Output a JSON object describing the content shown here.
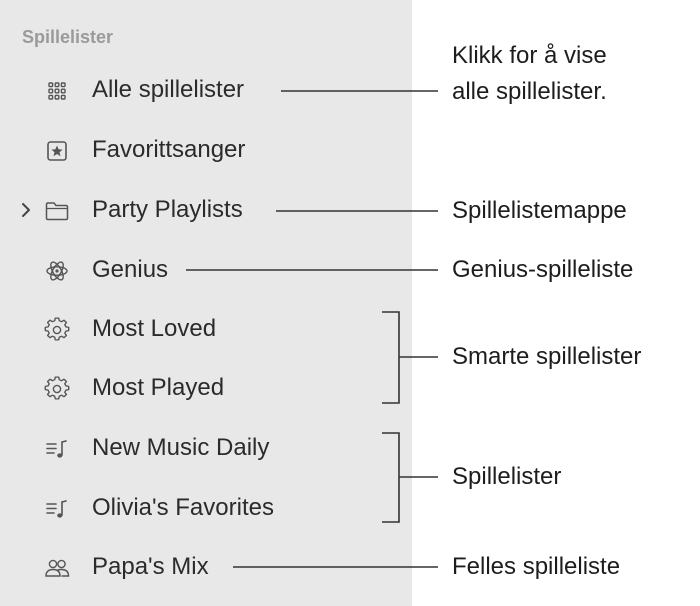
{
  "sidebar": {
    "section_title": "Spillelister",
    "items": [
      {
        "label": "Alle spillelister",
        "icon": "grid-icon"
      },
      {
        "label": "Favorittsanger",
        "icon": "star-box-icon"
      },
      {
        "label": "Party Playlists",
        "icon": "folder-icon"
      },
      {
        "label": "Genius",
        "icon": "genius-atom-icon"
      },
      {
        "label": "Most Loved",
        "icon": "smart-gear-icon"
      },
      {
        "label": "Most Played",
        "icon": "smart-gear-icon"
      },
      {
        "label": "New Music Daily",
        "icon": "playlist-note-icon"
      },
      {
        "label": "Olivia's Favorites",
        "icon": "playlist-note-icon"
      },
      {
        "label": "Papa's Mix",
        "icon": "people-icon"
      }
    ]
  },
  "callouts": {
    "all_playlists_line1": "Klikk for å vise",
    "all_playlists_line2": "alle spillelister.",
    "folder": "Spillelistemappe",
    "genius": "Genius-spilleliste",
    "smart": "Smarte spillelister",
    "playlists": "Spillelister",
    "shared": "Felles spilleliste"
  }
}
